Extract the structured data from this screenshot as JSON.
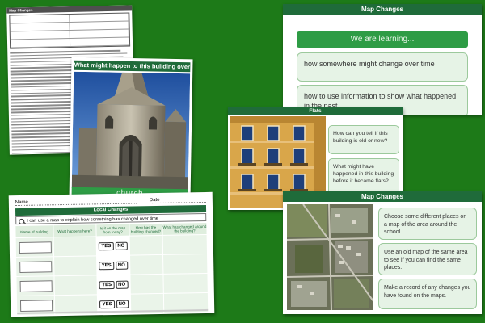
{
  "doc1": {
    "title": "Map Changes",
    "line_count": 42
  },
  "church_slide": {
    "title": "What might happen to this building over time?",
    "caption": "church"
  },
  "worksheet": {
    "name_label": "Name",
    "date_label": "Date",
    "title": "Local Changes",
    "objective": "I can use a map to explain how something has changed over time",
    "columns": [
      "Name of building",
      "What happens here?",
      "Is it on the map from today?",
      "How has the building changed?",
      "What has changed around the building?"
    ],
    "rows": [
      {
        "yes": "YES",
        "no": "NO"
      },
      {
        "yes": "YES",
        "no": "NO"
      },
      {
        "yes": "YES",
        "no": "NO"
      },
      {
        "yes": "YES",
        "no": "NO"
      }
    ]
  },
  "objectives_slide": {
    "title": "Map Changes",
    "learning_label": "We are learning...",
    "objectives": [
      "how somewhere might change over time",
      "how to use information to show what happened in the past"
    ]
  },
  "flats_slide": {
    "title": "Flats",
    "questions": [
      "How can you tell if this building is old or new?",
      "What might have happened in this building before it became flats?"
    ]
  },
  "aerial_slide": {
    "title": "Map Changes",
    "instructions": [
      "Choose some different places on a map of the area around the school.",
      "Use an old map of the same area to see if you can find the same places.",
      "Make a record of any changes you have found on the maps."
    ]
  },
  "colors": {
    "background": "#1d7a18",
    "title_bar": "#1f6b3a",
    "accent": "#2e9c45",
    "box_fill": "#e6f3e6"
  }
}
